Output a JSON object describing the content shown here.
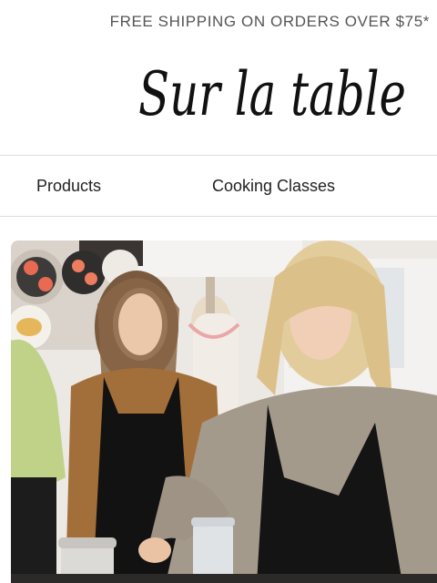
{
  "promo": {
    "text": "FREE SHIPPING ON ORDERS OVER $75*"
  },
  "brand": {
    "logo_text": "Sur la table",
    "logo_color": "#111111"
  },
  "nav": {
    "items": [
      {
        "label": "Products"
      },
      {
        "label": "Cooking Classes"
      }
    ]
  },
  "hero": {
    "image_icon": "cooking-class-photo"
  },
  "colors": {
    "promo_text": "#555555",
    "nav_text": "#222222",
    "divider": "#dcdcdc"
  }
}
